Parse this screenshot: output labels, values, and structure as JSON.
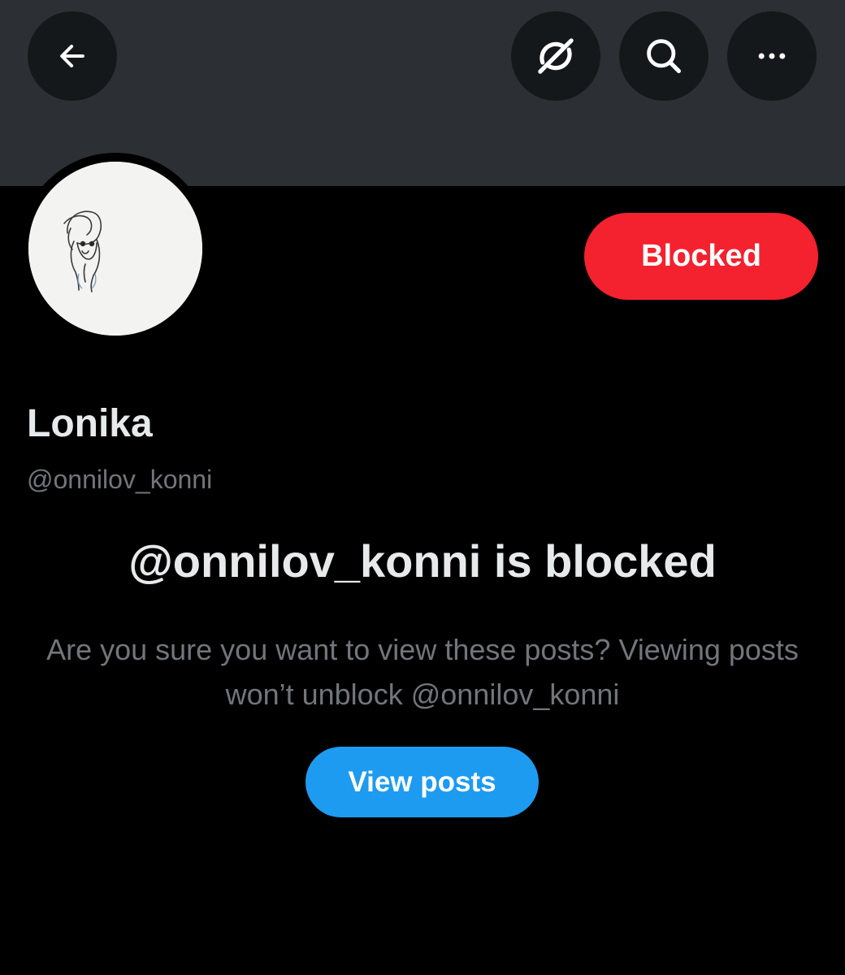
{
  "header": {
    "back_icon": "arrow-left-icon",
    "grok_icon": "grok-icon",
    "search_icon": "search-icon",
    "more_icon": "more-horizontal-icon"
  },
  "profile": {
    "avatar_icon": "sketch-avatar",
    "display_name": "Lonika",
    "handle": "@onnilov_konni",
    "block_button_label": "Blocked"
  },
  "blocked_notice": {
    "title": "@onnilov_konni is blocked",
    "description": "Are you sure you want to view these posts? Viewing posts won’t unblock @onnilov_konni",
    "view_button_label": "View posts"
  },
  "colors": {
    "background": "#000000",
    "banner": "#2c3035",
    "blocked_red": "#f4212e",
    "view_blue": "#1d9bf0",
    "muted_text": "#71767b",
    "primary_text": "#e7e9ea"
  }
}
